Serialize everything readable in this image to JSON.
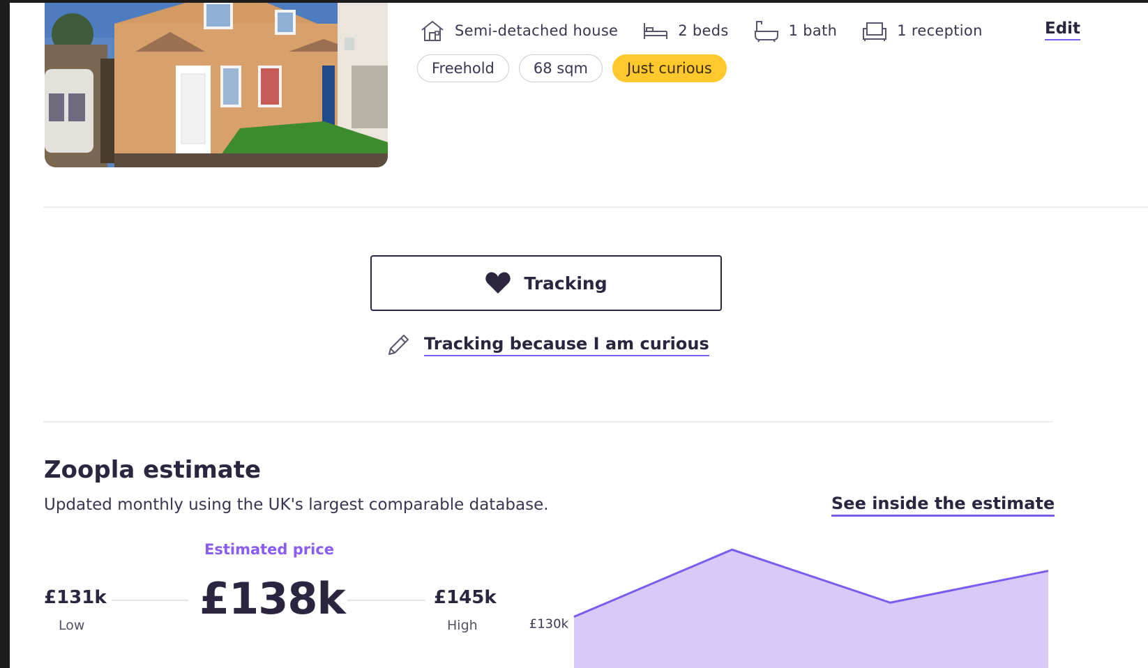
{
  "listing": {
    "photo_alt": "semi-detached-house-photo",
    "features": [
      {
        "icon": "house-icon",
        "label": "Semi-detached house"
      },
      {
        "icon": "bed-icon",
        "label": "2  beds"
      },
      {
        "icon": "bath-icon",
        "label": "1  bath"
      },
      {
        "icon": "sofa-icon",
        "label": "1  reception"
      }
    ],
    "edit_label": "Edit",
    "tags": [
      "Freehold",
      "68 sqm",
      "Just curious"
    ]
  },
  "tracking": {
    "button_label": "Tracking",
    "reason_label": "Tracking because I am curious"
  },
  "estimate": {
    "title": "Zoopla estimate",
    "subtitle": "Updated monthly using the UK's largest comparable database.",
    "see_inside_label": "See inside the estimate",
    "estimated_label": "Estimated price",
    "price": "£138k",
    "low_value": "£131k",
    "low_caption": "Low",
    "high_value": "£145k",
    "high_caption": "High"
  },
  "colors": {
    "accent": "#7b5cf0",
    "chart_fill": "#d9c9f7",
    "chart_line": "#7b5cf0",
    "tag_highlight": "#ffc82c",
    "text_dark": "#2b2540"
  },
  "chart_data": {
    "type": "area",
    "x": [
      0,
      1,
      2,
      3
    ],
    "values": [
      130.4,
      134.2,
      131.2,
      133.0
    ],
    "ytick_labels": [
      "£130k"
    ],
    "yticks": [
      130
    ],
    "ylim": [
      127.5,
      135
    ],
    "xlabel": "",
    "ylabel": "",
    "grid": false
  }
}
